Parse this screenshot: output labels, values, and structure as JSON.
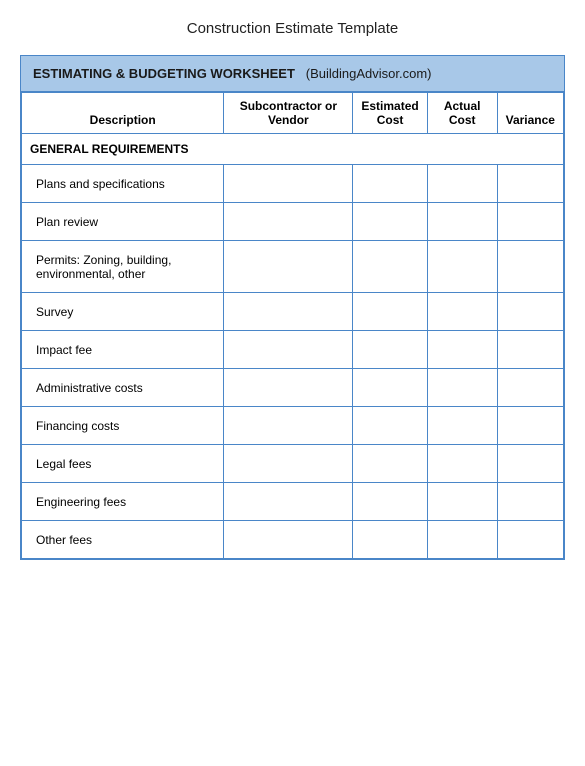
{
  "title": "Construction Estimate Template",
  "worksheet": {
    "header": "ESTIMATING & BUDGETING  WORKSHEET",
    "site": "(BuildingAdvisor.com)",
    "columns": {
      "description": "Description",
      "subcontractor": "Subcontractor or Vendor",
      "estimated_cost": "Estimated Cost",
      "actual_cost": "Actual Cost",
      "variance": "Variance"
    },
    "sections": [
      {
        "type": "section-header",
        "label": "GENERAL REQUIREMENTS"
      },
      {
        "type": "data-row",
        "description": "Plans and specifications"
      },
      {
        "type": "data-row",
        "description": "Plan review"
      },
      {
        "type": "data-row-tall",
        "description": "Permits:  Zoning, building, environmental, other"
      },
      {
        "type": "data-row",
        "description": "Survey"
      },
      {
        "type": "data-row",
        "description": "Impact fee"
      },
      {
        "type": "data-row",
        "description": "Administrative costs"
      },
      {
        "type": "data-row",
        "description": "Financing costs"
      },
      {
        "type": "data-row",
        "description": "Legal fees"
      },
      {
        "type": "data-row",
        "description": "Engineering fees"
      },
      {
        "type": "data-row",
        "description": "Other fees"
      }
    ]
  }
}
